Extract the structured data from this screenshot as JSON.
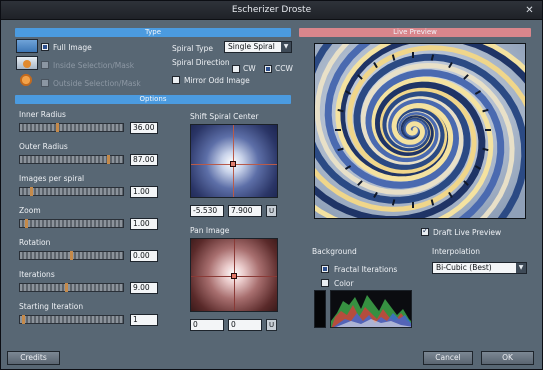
{
  "window": {
    "title": "Escherizer Droste"
  },
  "type_section": {
    "header": "Type",
    "full_image": "Full Image",
    "inside_selection": "Inside Selection/Mask",
    "outside_selection": "Outside Selection/Mask",
    "spiral_type_label": "Spiral Type",
    "spiral_type_value": "Single Spiral",
    "spiral_direction_label": "Spiral Direction",
    "cw_label": "CW",
    "ccw_label": "CCW",
    "mirror_label": "Mirror Odd Image"
  },
  "options_section": {
    "header": "Options",
    "sliders": [
      {
        "label": "Inner Radius",
        "value": "36.00",
        "level": 0.36
      },
      {
        "label": "Outer Radius",
        "value": "87.00",
        "level": 0.87
      },
      {
        "label": "Images per spiral",
        "value": "1.00",
        "level": 0.1
      },
      {
        "label": "Zoom",
        "value": "1.00",
        "level": 0.05
      },
      {
        "label": "Rotation",
        "value": "0.00",
        "level": 0.5
      },
      {
        "label": "Iterations",
        "value": "9.00",
        "level": 0.45
      },
      {
        "label": "Starting Iteration",
        "value": "1",
        "level": 0.02
      }
    ],
    "shift_center": {
      "label": "Shift Spiral Center",
      "x": "-5.530",
      "y": "7.900",
      "u": "U"
    },
    "pan_image": {
      "label": "Pan Image",
      "x": "0",
      "y": "0",
      "u": "U"
    }
  },
  "preview_section": {
    "header": "Live Preview",
    "draft_label": "Draft Live Preview",
    "background_label": "Background",
    "fractal_label": "Fractal Iterations",
    "color_label": "Color",
    "interpolation_label": "Interpolation",
    "interpolation_value": "Bi-Cubic (Best)"
  },
  "footer": {
    "credits": "Credits",
    "cancel": "Cancel",
    "ok": "OK"
  },
  "colors": {
    "section_blue": "#4b9be0",
    "section_pink": "#d9868c",
    "panel": "#586774"
  }
}
